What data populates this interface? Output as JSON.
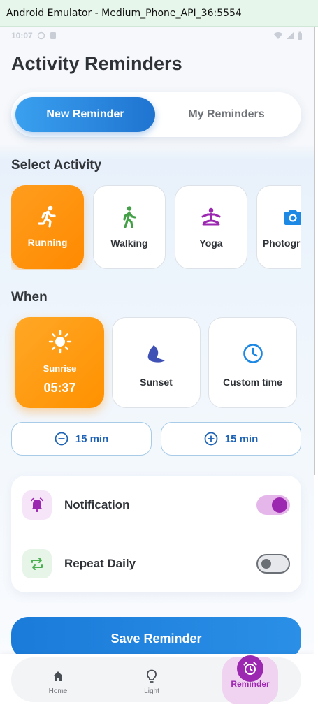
{
  "window": {
    "title": "Android Emulator - Medium_Phone_API_36:5554"
  },
  "status_bar": {
    "time": "10:07"
  },
  "page": {
    "title": "Activity Reminders"
  },
  "tabs": [
    {
      "label": "New Reminder",
      "active": true
    },
    {
      "label": "My Reminders",
      "active": false
    }
  ],
  "activity_section": {
    "title": "Select Activity",
    "items": [
      {
        "label": "Running",
        "icon": "running-icon",
        "selected": true
      },
      {
        "label": "Walking",
        "icon": "walking-icon",
        "selected": false
      },
      {
        "label": "Yoga",
        "icon": "yoga-icon",
        "selected": false
      },
      {
        "label": "Photography",
        "icon": "camera-icon",
        "selected": false
      }
    ]
  },
  "when_section": {
    "title": "When",
    "options": [
      {
        "label": "Sunrise",
        "time": "05:37",
        "icon": "sun-icon",
        "selected": true
      },
      {
        "label": "Sunset",
        "icon": "moon-icon",
        "selected": false
      },
      {
        "label": "Custom time",
        "icon": "clock-icon",
        "selected": false
      }
    ]
  },
  "offsets": [
    {
      "label": "15 min",
      "icon": "minus-circle-icon"
    },
    {
      "label": "15 min",
      "icon": "plus-circle-icon"
    }
  ],
  "settings": [
    {
      "label": "Notification",
      "icon": "alarm-bell-icon",
      "enabled": true
    },
    {
      "label": "Repeat Daily",
      "icon": "repeat-icon",
      "enabled": false
    }
  ],
  "save_button": {
    "label": "Save Reminder"
  },
  "bottom_nav": [
    {
      "label": "Home",
      "icon": "home-icon",
      "active": false
    },
    {
      "label": "Light",
      "icon": "lightbulb-icon",
      "active": false
    },
    {
      "label": "Reminder",
      "icon": "alarm-clock-icon",
      "active": true
    }
  ],
  "colors": {
    "primary_blue": "#1f74d0",
    "accent_orange": "#ff9100",
    "accent_purple": "#9c27b0",
    "walking_green": "#43a047",
    "repeat_green": "#4caf50"
  }
}
